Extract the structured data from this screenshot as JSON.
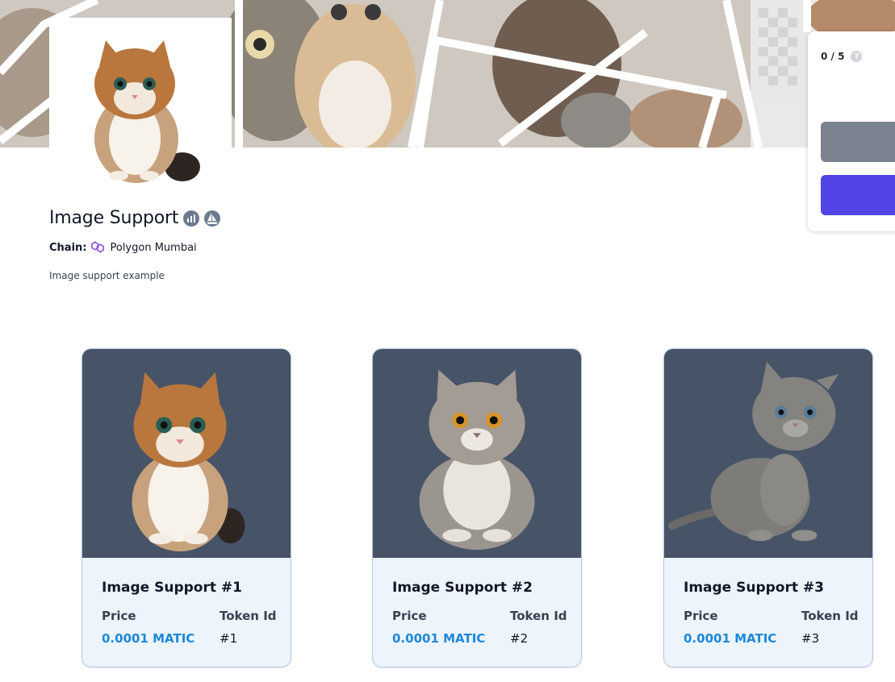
{
  "collection": {
    "title": "Image Support",
    "chain_label": "Chain:",
    "chain_value": "Polygon Mumbai",
    "description": "Image support example",
    "icons": [
      "chart-icon",
      "opensea-icon"
    ]
  },
  "mint_panel": {
    "count": "0 / 5",
    "help_glyph": "?"
  },
  "cards": [
    {
      "title": "Image Support #1",
      "price_label": "Price",
      "price": "0.0001 MATIC",
      "token_label": "Token Id",
      "token_id": "#1"
    },
    {
      "title": "Image Support #2",
      "price_label": "Price",
      "price": "0.0001 MATIC",
      "token_label": "Token Id",
      "token_id": "#2"
    },
    {
      "title": "Image Support #3",
      "price_label": "Price",
      "price": "0.0001 MATIC",
      "token_label": "Token Id",
      "token_id": "#3"
    }
  ],
  "colors": {
    "price": "#1a88d8",
    "primary_button": "#5145e5",
    "secondary_button": "#7c8290",
    "card_image_bg": "#475467",
    "card_bg": "#eef4fc"
  }
}
